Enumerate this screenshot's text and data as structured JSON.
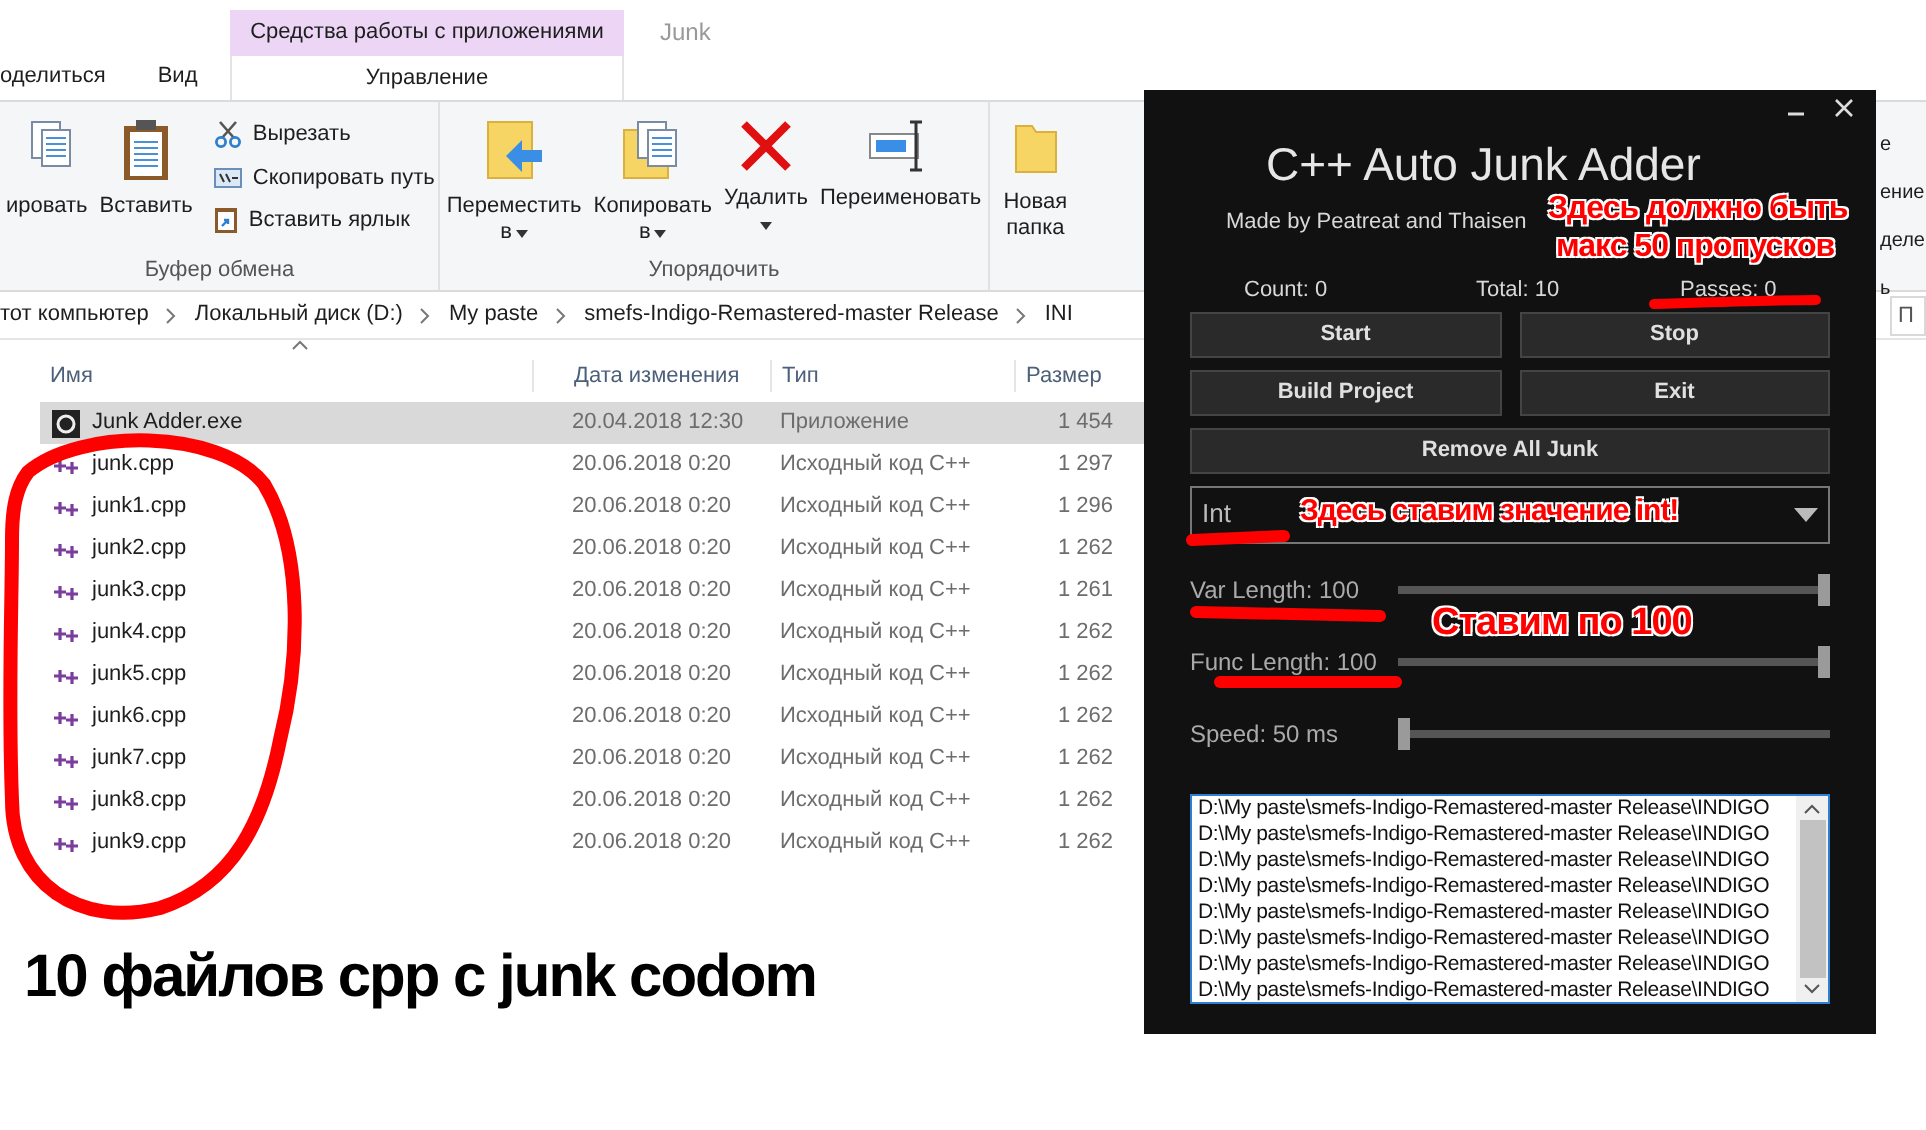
{
  "ribbon_tabs": {
    "context_header": "Средства работы с приложениями",
    "title": "Junk",
    "tabs": [
      {
        "label": "оделиться",
        "selected": false
      },
      {
        "label": "Вид",
        "selected": false
      },
      {
        "label": "Управление",
        "selected": true
      }
    ]
  },
  "ribbon": {
    "groups": [
      {
        "label": "Буфер обмена",
        "big": [
          {
            "label": "ировать"
          },
          {
            "label": "Вставить"
          }
        ],
        "small": [
          {
            "label": "Вырезать"
          },
          {
            "label": "Скопировать путь"
          },
          {
            "label": "Вставить ярлык"
          }
        ]
      },
      {
        "label": "Упорядочить",
        "big": [
          {
            "label": "Переместить",
            "sub": "в"
          },
          {
            "label": "Копировать",
            "sub": "в"
          },
          {
            "label": "Удалить"
          },
          {
            "label": "Переименовать"
          }
        ]
      },
      {
        "big": [
          {
            "label": "Новая папка"
          }
        ]
      }
    ],
    "right_fragments": [
      "е",
      "ение",
      "деле",
      "ь"
    ]
  },
  "address_bar": {
    "crumbs": [
      "тот компьютер",
      "Локальный диск (D:)",
      "My paste",
      "smefs-Indigo-Remastered-master Release",
      "INI"
    ]
  },
  "search": {
    "placeholder": "П"
  },
  "file_list": {
    "columns": [
      "Имя",
      "Дата изменения",
      "Тип",
      "Размер"
    ],
    "rows": [
      {
        "name": "Junk Adder.exe",
        "date": "20.04.2018 12:30",
        "type": "Приложение",
        "size": "1 454",
        "kind": "exe",
        "selected": true
      },
      {
        "name": "junk.cpp",
        "date": "20.06.2018 0:20",
        "type": "Исходный код C++",
        "size": "1 297",
        "kind": "cpp",
        "selected": false
      },
      {
        "name": "junk1.cpp",
        "date": "20.06.2018 0:20",
        "type": "Исходный код C++",
        "size": "1 296",
        "kind": "cpp",
        "selected": false
      },
      {
        "name": "junk2.cpp",
        "date": "20.06.2018 0:20",
        "type": "Исходный код C++",
        "size": "1 262",
        "kind": "cpp",
        "selected": false
      },
      {
        "name": "junk3.cpp",
        "date": "20.06.2018 0:20",
        "type": "Исходный код C++",
        "size": "1 261",
        "kind": "cpp",
        "selected": false
      },
      {
        "name": "junk4.cpp",
        "date": "20.06.2018 0:20",
        "type": "Исходный код C++",
        "size": "1 262",
        "kind": "cpp",
        "selected": false
      },
      {
        "name": "junk5.cpp",
        "date": "20.06.2018 0:20",
        "type": "Исходный код C++",
        "size": "1 262",
        "kind": "cpp",
        "selected": false
      },
      {
        "name": "junk6.cpp",
        "date": "20.06.2018 0:20",
        "type": "Исходный код C++",
        "size": "1 262",
        "kind": "cpp",
        "selected": false
      },
      {
        "name": "junk7.cpp",
        "date": "20.06.2018 0:20",
        "type": "Исходный код C++",
        "size": "1 262",
        "kind": "cpp",
        "selected": false
      },
      {
        "name": "junk8.cpp",
        "date": "20.06.2018 0:20",
        "type": "Исходный код C++",
        "size": "1 262",
        "kind": "cpp",
        "selected": false
      },
      {
        "name": "junk9.cpp",
        "date": "20.06.2018 0:20",
        "type": "Исходный код C++",
        "size": "1 262",
        "kind": "cpp",
        "selected": false
      }
    ]
  },
  "app_window": {
    "title": "C++ Auto Junk Adder",
    "subtitle": "Made by Peatreat and Thaisen",
    "stats": [
      "Count: 0",
      "Total: 10",
      "Passes: 0"
    ],
    "buttons": [
      [
        "Start",
        "Stop"
      ],
      [
        "Build Project",
        "Exit"
      ],
      [
        "Remove All Junk"
      ]
    ],
    "dropdown": {
      "value": "Int"
    },
    "sliders": [
      {
        "label": "Var Length: 100",
        "level": 1
      },
      {
        "label": "Func Length: 100",
        "level": 1
      },
      {
        "label": "Speed: 50 ms",
        "level": 0
      }
    ],
    "log": [
      "D:\\My paste\\smefs-Indigo-Remastered-master Release\\INDIGO",
      "D:\\My paste\\smefs-Indigo-Remastered-master Release\\INDIGO",
      "D:\\My paste\\smefs-Indigo-Remastered-master Release\\INDIGO",
      "D:\\My paste\\smefs-Indigo-Remastered-master Release\\INDIGO",
      "D:\\My paste\\smefs-Indigo-Remastered-master Release\\INDIGO",
      "D:\\My paste\\smefs-Indigo-Remastered-master Release\\INDIGO",
      "D:\\My paste\\smefs-Indigo-Remastered-master Release\\INDIGO",
      "D:\\My paste\\smefs-Indigo-Remastered-master Release\\INDIGO"
    ]
  },
  "annotations": [
    {
      "kind": "callout",
      "text": "Здесь должно быть"
    },
    {
      "kind": "callout",
      "text": "макс 50 пропусков"
    },
    {
      "kind": "callout",
      "text": "Здесь ставим значение int!"
    },
    {
      "kind": "callout",
      "text": "Ставим по 100"
    },
    {
      "kind": "caption",
      "text": "10 файлов cpp с junk codom"
    }
  ]
}
